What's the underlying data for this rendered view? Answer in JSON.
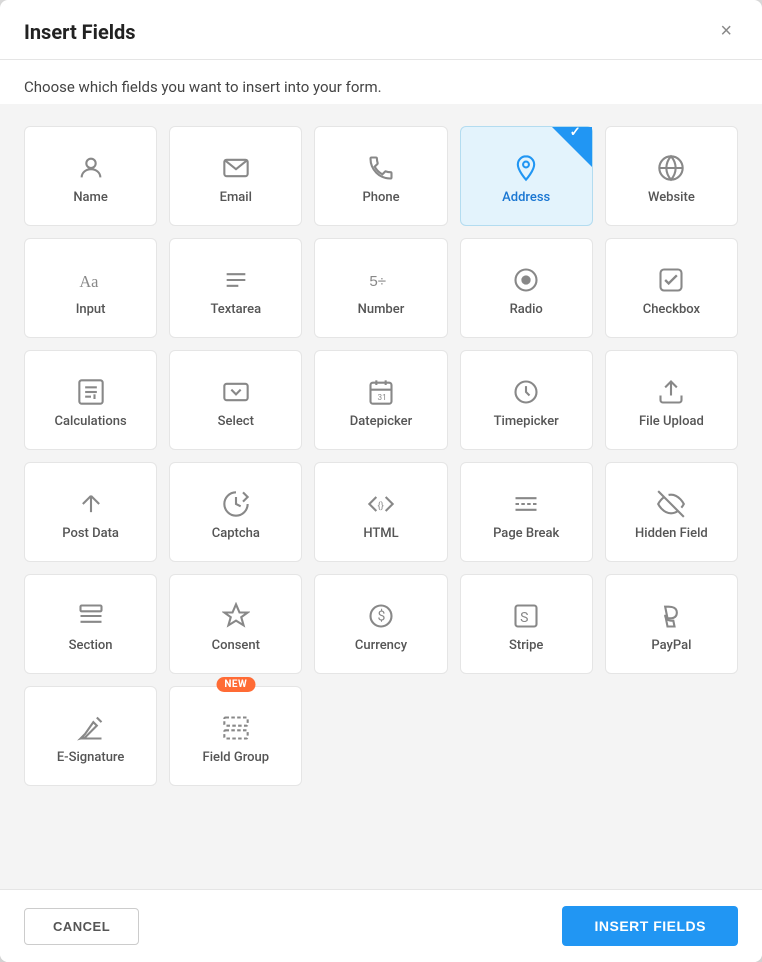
{
  "modal": {
    "title": "Insert Fields",
    "subtitle": "Choose which fields you want to insert into your form.",
    "close_label": "×"
  },
  "footer": {
    "cancel_label": "CANCEL",
    "insert_label": "INSERT FIELDS"
  },
  "fields": [
    {
      "id": "name",
      "label": "Name",
      "icon": "name",
      "selected": false
    },
    {
      "id": "email",
      "label": "Email",
      "icon": "email",
      "selected": false
    },
    {
      "id": "phone",
      "label": "Phone",
      "icon": "phone",
      "selected": false
    },
    {
      "id": "address",
      "label": "Address",
      "icon": "address",
      "selected": true
    },
    {
      "id": "website",
      "label": "Website",
      "icon": "website",
      "selected": false
    },
    {
      "id": "input",
      "label": "Input",
      "icon": "input",
      "selected": false
    },
    {
      "id": "textarea",
      "label": "Textarea",
      "icon": "textarea",
      "selected": false
    },
    {
      "id": "number",
      "label": "Number",
      "icon": "number",
      "selected": false
    },
    {
      "id": "radio",
      "label": "Radio",
      "icon": "radio",
      "selected": false
    },
    {
      "id": "checkbox",
      "label": "Checkbox",
      "icon": "checkbox",
      "selected": false
    },
    {
      "id": "calculations",
      "label": "Calculations",
      "icon": "calculations",
      "selected": false
    },
    {
      "id": "select",
      "label": "Select",
      "icon": "select",
      "selected": false
    },
    {
      "id": "datepicker",
      "label": "Datepicker",
      "icon": "datepicker",
      "selected": false
    },
    {
      "id": "timepicker",
      "label": "Timepicker",
      "icon": "timepicker",
      "selected": false
    },
    {
      "id": "file-upload",
      "label": "File Upload",
      "icon": "file-upload",
      "selected": false
    },
    {
      "id": "post-data",
      "label": "Post Data",
      "icon": "post-data",
      "selected": false
    },
    {
      "id": "captcha",
      "label": "Captcha",
      "icon": "captcha",
      "selected": false
    },
    {
      "id": "html",
      "label": "HTML",
      "icon": "html",
      "selected": false
    },
    {
      "id": "page-break",
      "label": "Page Break",
      "icon": "page-break",
      "selected": false
    },
    {
      "id": "hidden-field",
      "label": "Hidden Field",
      "icon": "hidden-field",
      "selected": false
    },
    {
      "id": "section",
      "label": "Section",
      "icon": "section",
      "selected": false
    },
    {
      "id": "consent",
      "label": "Consent",
      "icon": "consent",
      "selected": false
    },
    {
      "id": "currency",
      "label": "Currency",
      "icon": "currency",
      "selected": false
    },
    {
      "id": "stripe",
      "label": "Stripe",
      "icon": "stripe",
      "selected": false
    },
    {
      "id": "paypal",
      "label": "PayPal",
      "icon": "paypal",
      "selected": false
    },
    {
      "id": "e-signature",
      "label": "E-Signature",
      "icon": "e-signature",
      "selected": false
    },
    {
      "id": "field-group",
      "label": "Field Group",
      "icon": "field-group",
      "selected": false,
      "new": true
    }
  ]
}
